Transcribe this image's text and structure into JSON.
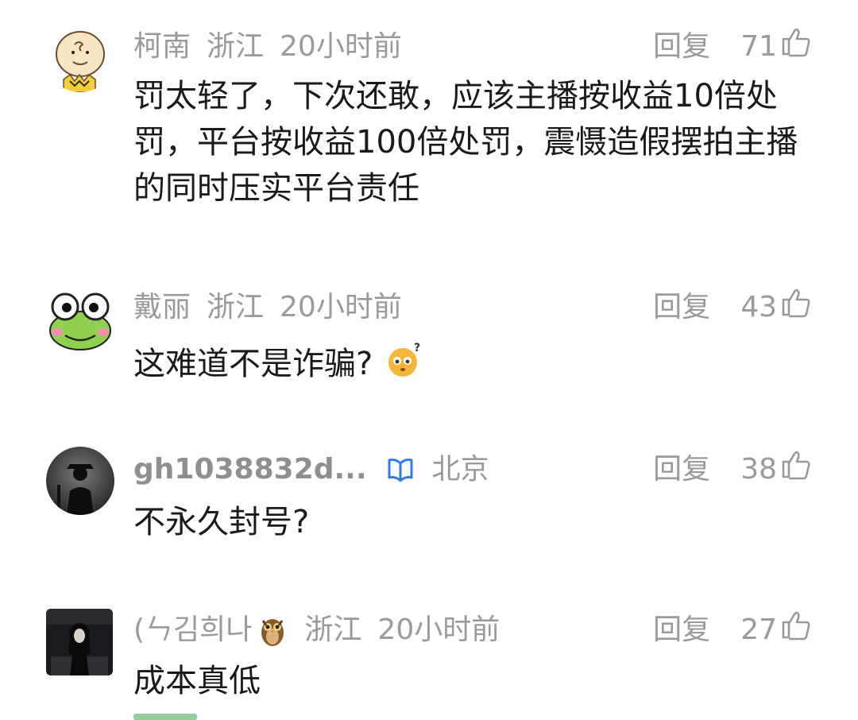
{
  "comments": [
    {
      "user": "柯南",
      "location": "浙江",
      "time": "20小时前",
      "reply_label": "回复",
      "likes": "71",
      "text": "罚太轻了，下次还敢，应该主播按收益10倍处罚，平台按收益100倍处罚，震慑造假摆拍主播的同时压实平台责任",
      "avatar_icon": "charlie-brown-avatar"
    },
    {
      "user": "戴丽",
      "location": "浙江",
      "time": "20小时前",
      "reply_label": "回复",
      "likes": "43",
      "text": "这难道不是诈骗?",
      "avatar_icon": "frog-avatar",
      "emoji": "confused-face-emoji"
    },
    {
      "user": "gh1038832d...",
      "location": "北京",
      "time": "",
      "reply_label": "回复",
      "likes": "38",
      "text": "不永久封号?",
      "avatar_icon": "silhouette-avatar",
      "badge_icon": "verified-book-icon"
    },
    {
      "user": "(ㄣ김희나",
      "location": "浙江",
      "time": "20小时前",
      "reply_label": "回复",
      "likes": "27",
      "text": "成本真低",
      "avatar_icon": "dark-portrait-avatar",
      "name_emoji": "owl-emoji"
    }
  ],
  "colors": {
    "meta": "#9a9a9a",
    "text": "#1a1a1a",
    "verify": "#2f7de1"
  }
}
